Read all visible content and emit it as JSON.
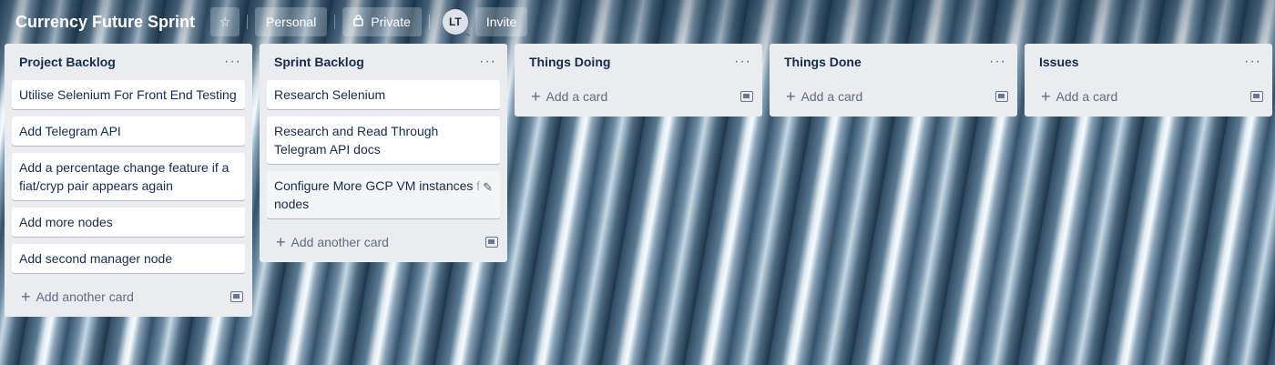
{
  "board": {
    "title": "Currency Future Sprint",
    "team_label": "Personal",
    "visibility_label": "Private",
    "member_initials": "LT",
    "invite_label": "Invite"
  },
  "lists": [
    {
      "title": "Project Backlog",
      "cards": [
        "Utilise Selenium For Front End Testing",
        "Add Telegram API",
        "Add a percentage change feature if a fiat/cryp pair appears again",
        "Add more nodes",
        "Add second manager node"
      ],
      "footer": "Add another card"
    },
    {
      "title": "Sprint Backlog",
      "cards": [
        "Research Selenium",
        "Research and Read Through Telegram API docs",
        "Configure More GCP VM instances for nodes"
      ],
      "footer": "Add another card"
    },
    {
      "title": "Things Doing",
      "cards": [],
      "footer": "Add a card"
    },
    {
      "title": "Things Done",
      "cards": [],
      "footer": "Add a card"
    },
    {
      "title": "Issues",
      "cards": [],
      "footer": "Add a card"
    }
  ],
  "icons": {
    "star": "star-icon",
    "lock": "lock-icon",
    "list_menu": "more-horizontal-icon",
    "add": "plus-icon",
    "template": "card-template-icon",
    "edit": "pencil-icon"
  }
}
